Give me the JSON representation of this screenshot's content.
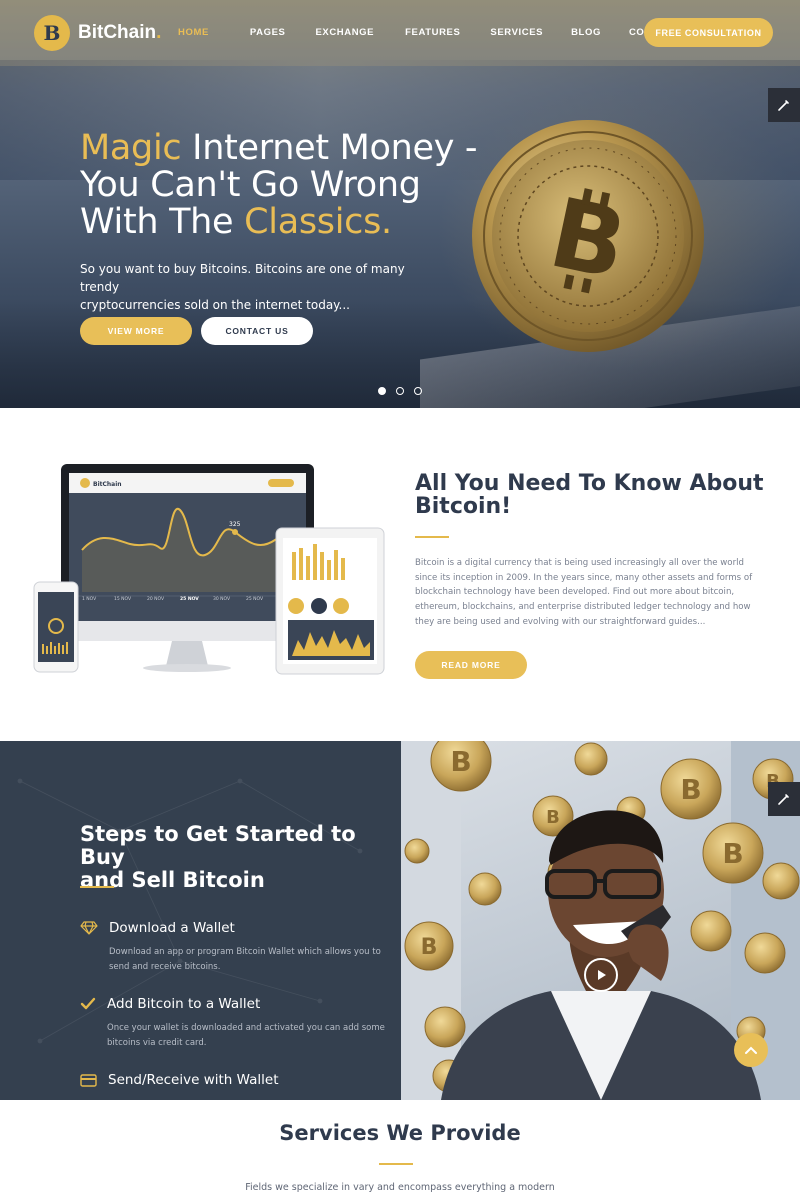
{
  "brand": {
    "name": "BitChain",
    "dot": ".",
    "mark": "B"
  },
  "nav": {
    "items": [
      "HOME",
      "PAGES",
      "EXCHANGE",
      "FEATURES",
      "SERVICES",
      "BLOG",
      "CONTACTS"
    ],
    "active": "HOME",
    "cta": "FREE CONSULTATION"
  },
  "hero": {
    "title_line1_gold": "Magic",
    "title_line1_rest": " Internet Money -",
    "title_line2": "You Can't Go Wrong",
    "title_line3_rest": "With The ",
    "title_line3_gold": "Classics.",
    "subtitle_line1": "So you want to buy Bitcoins. Bitcoins are one of many trendy",
    "subtitle_line2": "cryptocurrencies sold on the internet today...",
    "btn_primary": "VIEW MORE",
    "btn_secondary": "CONTACT US",
    "slides": 3,
    "active_slide": 1
  },
  "about": {
    "title_line1": "All You Need To Know About",
    "title_line2": "Bitcoin!",
    "body": "Bitcoin is a digital currency that is being used increasingly all over the world since its inception in 2009. In the years since, many other assets and forms of blockchain technology have been developed. Find out more about bitcoin, ethereum, blockchains, and enterprise distributed ledger technology and how they are being used and evolving with our straightforward guides...",
    "button": "READ MORE",
    "mockup": {
      "brand": "BitChain",
      "peak_label": "325",
      "dates": [
        "1 NOV",
        "15 NOV",
        "20 NOV",
        "25 NOV",
        "30 NOV",
        "25 NOV"
      ]
    }
  },
  "steps": {
    "title_line1": "Steps to Get Started to Buy",
    "title_line2": "and Sell Bitcoin",
    "items": [
      {
        "icon": "diamond-icon",
        "title": "Download a Wallet",
        "desc_line1": "Download an app or program Bitcoin Wallet which allows you to",
        "desc_line2": "send and receive bitcoins."
      },
      {
        "icon": "check-icon",
        "title": "Add Bitcoin to a Wallet",
        "desc_line1": "Once your wallet is downloaded and activated you can add some",
        "desc_line2": "bitcoins via credit card."
      },
      {
        "icon": "card-icon",
        "title": "Send/Receive with Wallet"
      }
    ]
  },
  "services": {
    "title": "Services We Provide",
    "subtitle": "Fields we specialize in vary and encompass everything a modern"
  },
  "colors": {
    "gold": "#e8bf58",
    "navy": "#34404f",
    "text": "#2f3a4d",
    "muted": "#7a8190"
  }
}
